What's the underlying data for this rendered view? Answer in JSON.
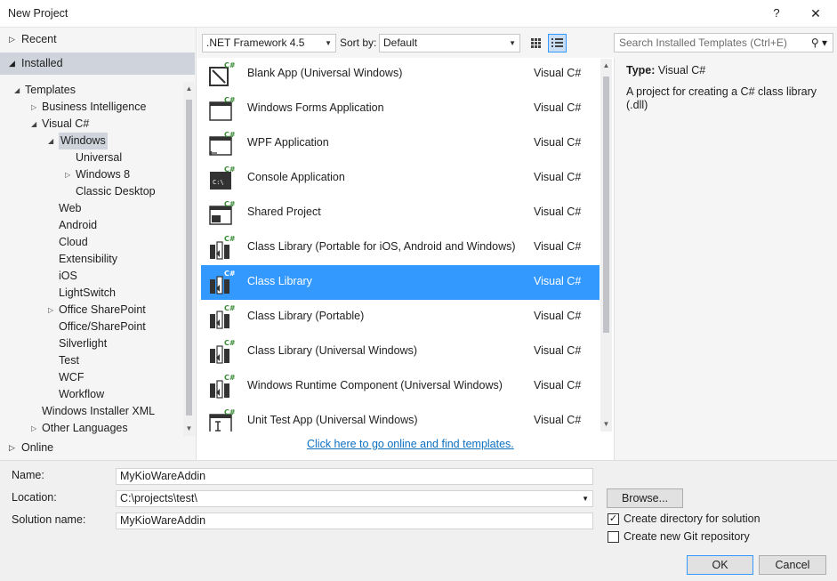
{
  "window": {
    "title": "New Project",
    "help_label": "?",
    "close_label": "✕"
  },
  "left": {
    "recent_label": "Recent",
    "installed_label": "Installed",
    "online_label": "Online",
    "tree": [
      {
        "label": "Templates",
        "expander": "◢"
      },
      {
        "label": "Business Intelligence",
        "expander": "▷"
      },
      {
        "label": "Visual C#",
        "expander": "◢"
      },
      {
        "label": "Windows",
        "expander": "◢",
        "selected": true
      },
      {
        "label": "Universal",
        "expander": ""
      },
      {
        "label": "Windows 8",
        "expander": "▷"
      },
      {
        "label": "Classic Desktop",
        "expander": ""
      },
      {
        "label": "Web",
        "expander": ""
      },
      {
        "label": "Android",
        "expander": ""
      },
      {
        "label": "Cloud",
        "expander": ""
      },
      {
        "label": "Extensibility",
        "expander": ""
      },
      {
        "label": "iOS",
        "expander": ""
      },
      {
        "label": "LightSwitch",
        "expander": ""
      },
      {
        "label": "Office SharePoint",
        "expander": "▷"
      },
      {
        "label": "Office/SharePoint",
        "expander": ""
      },
      {
        "label": "Silverlight",
        "expander": ""
      },
      {
        "label": "Test",
        "expander": ""
      },
      {
        "label": "WCF",
        "expander": ""
      },
      {
        "label": "Workflow",
        "expander": ""
      },
      {
        "label": "Windows Installer XML",
        "expander": ""
      },
      {
        "label": "Other Languages",
        "expander": "▷"
      }
    ]
  },
  "toolbar": {
    "framework": ".NET Framework 4.5",
    "sort_by_label": "Sort by:",
    "sort_value": "Default",
    "search_placeholder": "Search Installed Templates (Ctrl+E)"
  },
  "templates": [
    {
      "name": "Blank App (Universal Windows)",
      "lang": "Visual C#",
      "icon": "blank-app-icon"
    },
    {
      "name": "Windows Forms Application",
      "lang": "Visual C#",
      "icon": "winforms-icon"
    },
    {
      "name": "WPF Application",
      "lang": "Visual C#",
      "icon": "wpf-icon"
    },
    {
      "name": "Console Application",
      "lang": "Visual C#",
      "icon": "console-icon"
    },
    {
      "name": "Shared Project",
      "lang": "Visual C#",
      "icon": "shared-project-icon"
    },
    {
      "name": "Class Library (Portable for iOS, Android and Windows)",
      "lang": "Visual C#",
      "icon": "class-library-icon"
    },
    {
      "name": "Class Library",
      "lang": "Visual C#",
      "icon": "class-library-icon",
      "selected": true
    },
    {
      "name": "Class Library (Portable)",
      "lang": "Visual C#",
      "icon": "class-library-icon"
    },
    {
      "name": "Class Library (Universal Windows)",
      "lang": "Visual C#",
      "icon": "class-library-icon"
    },
    {
      "name": "Windows Runtime Component (Universal Windows)",
      "lang": "Visual C#",
      "icon": "class-library-icon"
    },
    {
      "name": "Unit Test App (Universal Windows)",
      "lang": "Visual C#",
      "icon": "unit-test-icon"
    }
  ],
  "online_link": "Click here to go online and find templates.",
  "details": {
    "type_label": "Type:",
    "type_value": "Visual C#",
    "description": "A project for creating a C# class library (.dll)"
  },
  "form": {
    "name_label": "Name:",
    "name_value": "MyKioWareAddin",
    "location_label": "Location:",
    "location_value": "C:\\projects\\test\\",
    "solution_label": "Solution name:",
    "solution_value": "MyKioWareAddin",
    "browse_label": "Browse...",
    "create_dir_label": "Create directory for solution",
    "create_dir_checked": true,
    "git_label": "Create new Git repository",
    "git_checked": false,
    "ok_label": "OK",
    "cancel_label": "Cancel"
  },
  "colors": {
    "selection": "#3399ff",
    "tree_selection": "#cfd4dc",
    "link": "#0e70c0"
  }
}
